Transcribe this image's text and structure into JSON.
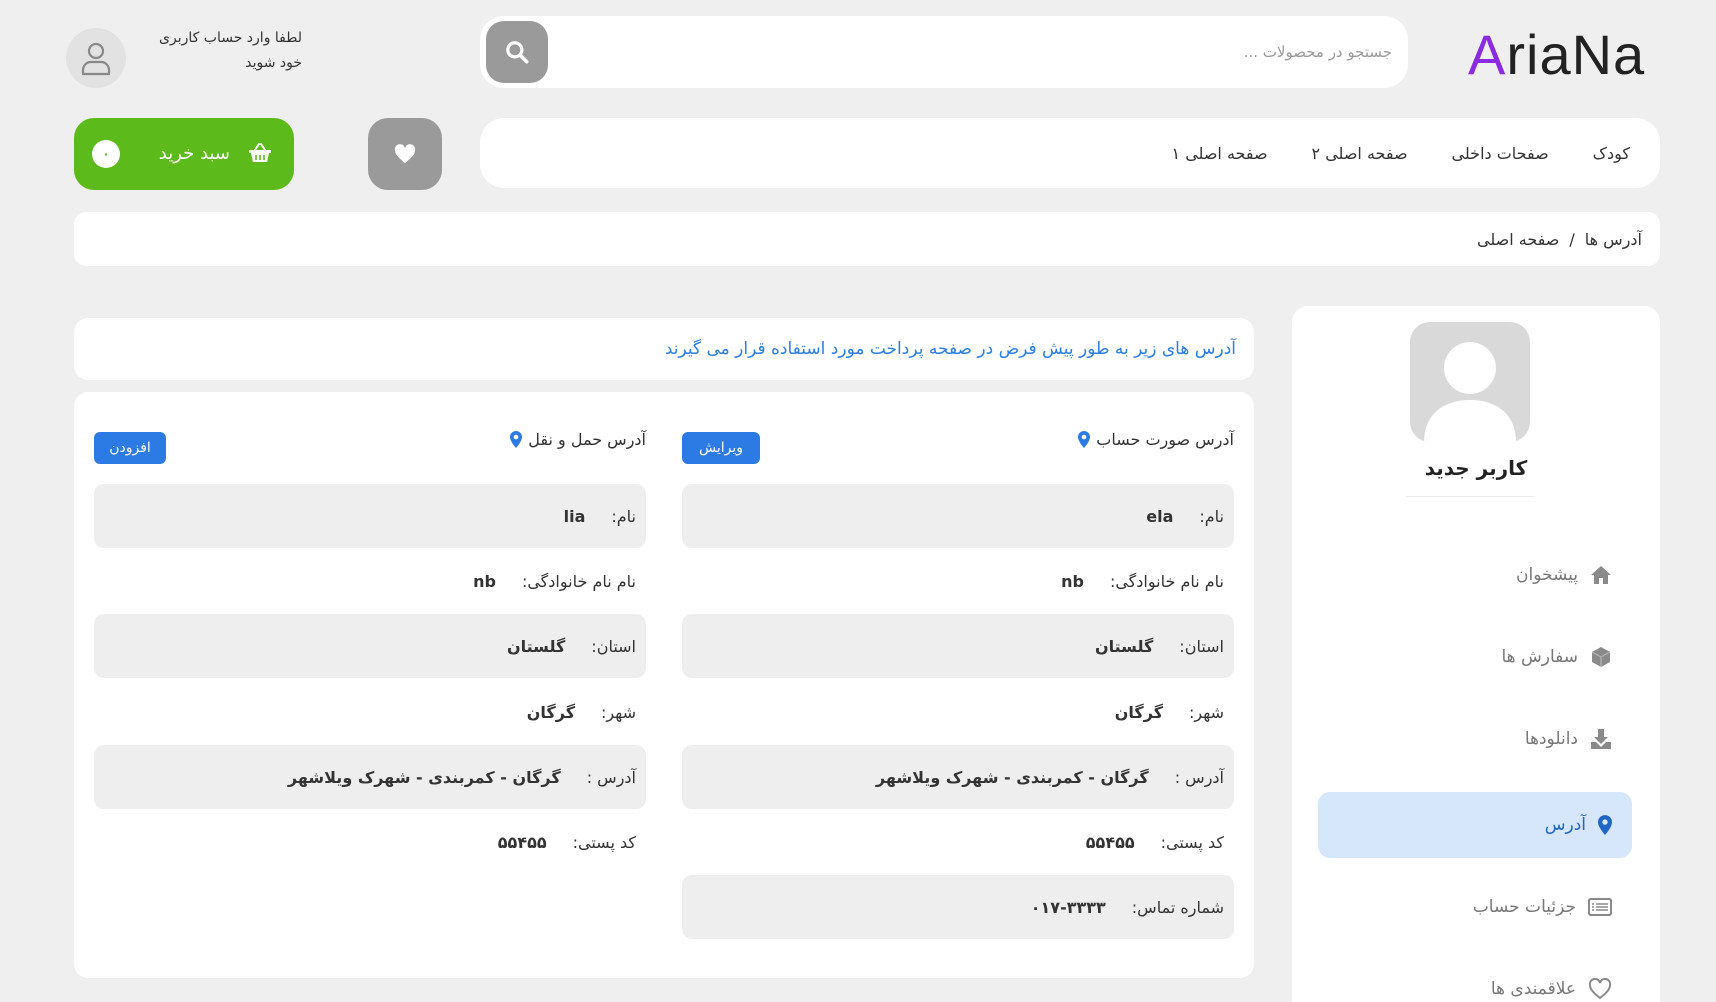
{
  "header": {
    "logo": {
      "first": "A",
      "rest": "riaNa",
      "accent_color": "#8a2be2"
    },
    "search": {
      "placeholder": "جستجو در محصولات ...",
      "value": ""
    },
    "login_prompt": {
      "line1": "لطفا وارد حساب کاربری",
      "line2": "خود شوید"
    },
    "icons": {
      "search": "search-icon",
      "user": "user-icon"
    }
  },
  "nav": {
    "items": [
      "صفحه اصلی ۱",
      "صفحه اصلی ۲",
      "صفحات داخلی",
      "کودک"
    ]
  },
  "cart": {
    "label": "سبد خرید",
    "count": "۰",
    "color": "#5cbb1a"
  },
  "breadcrumb": {
    "home": "صفحه اصلی",
    "separator": "/",
    "current": "آدرس ها"
  },
  "notice": "آدرس های زیر به طور پیش فرض در صفحه پرداخت مورد استفاده قرار می گیرند",
  "billing": {
    "title": "آدرس صورت حساب",
    "action": "ویرایش",
    "fields": [
      {
        "label": "نام:",
        "value": "ela"
      },
      {
        "label": "نام نام خانوادگی:",
        "value": "nb"
      },
      {
        "label": "استان:",
        "value": "گلستان"
      },
      {
        "label": "شهر:",
        "value": "گرگان"
      },
      {
        "label": "آدرس :",
        "value": "گرگان - کمربندی - شهرک ویلاشهر"
      },
      {
        "label": "کد پستی:",
        "value": "۵۵۴۵۵"
      },
      {
        "label": "شماره تماس:",
        "value": "۰۱۷-۳۳۳۳"
      }
    ]
  },
  "shipping": {
    "title": "آدرس حمل و نقل",
    "action": "افزودن",
    "fields": [
      {
        "label": "نام:",
        "value": "lia"
      },
      {
        "label": "نام نام خانوادگی:",
        "value": "nb"
      },
      {
        "label": "استان:",
        "value": "گلستان"
      },
      {
        "label": "شهر:",
        "value": "گرگان"
      },
      {
        "label": "آدرس :",
        "value": "گرگان - کمربندی - شهرک ویلاشهر"
      },
      {
        "label": "کد پستی:",
        "value": "۵۵۴۵۵"
      }
    ]
  },
  "sidebar": {
    "profile_name": "کاربر جدید",
    "menu": [
      {
        "label": "پیشخوان",
        "icon": "home-icon"
      },
      {
        "label": "سفارش ها",
        "icon": "box-icon"
      },
      {
        "label": "دانلودها",
        "icon": "download-icon"
      },
      {
        "label": "آدرس",
        "icon": "map-pin-icon",
        "active": true
      },
      {
        "label": "جزئیات حساب",
        "icon": "id-card-icon"
      },
      {
        "label": "علاقمندی ها",
        "icon": "heart-icon"
      }
    ]
  },
  "colors": {
    "accent_blue": "#2c7be5",
    "active_bg": "#d6e7fc",
    "background": "#efefef"
  }
}
